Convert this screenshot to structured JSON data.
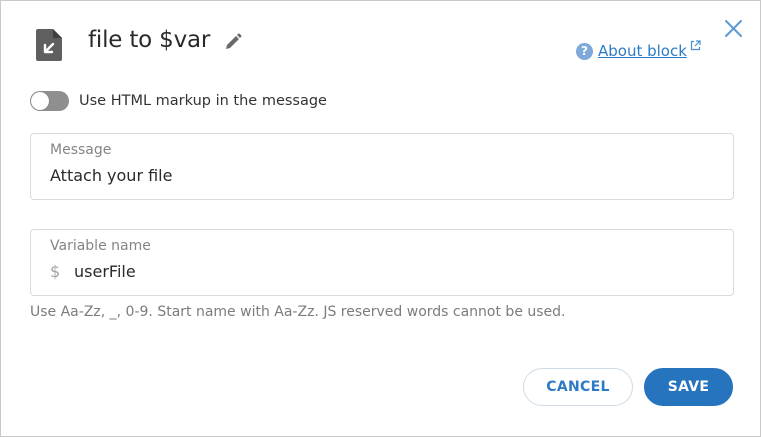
{
  "dialog": {
    "title": "file to $var",
    "about_link": "About block",
    "help_glyph": "?",
    "icons": {
      "block": "file-export-icon",
      "edit": "pencil-icon",
      "help": "question-circle-icon",
      "external": "external-link-icon",
      "close": "close-icon"
    }
  },
  "toggle": {
    "label": "Use HTML markup in the message",
    "checked": false
  },
  "message_field": {
    "label": "Message",
    "value": "Attach your file"
  },
  "variable_field": {
    "label": "Variable name",
    "prefix": "$",
    "value": "userFile"
  },
  "hint": "Use Aa-Zz, _, 0-9. Start name with Aa-Zz. JS reserved words cannot be used.",
  "buttons": {
    "cancel": "CANCEL",
    "save": "SAVE"
  },
  "colors": {
    "accent": "#2674bd",
    "link": "#2d7bc4",
    "toggle_off": "#8f8f8f",
    "close": "#5b9bd5"
  }
}
